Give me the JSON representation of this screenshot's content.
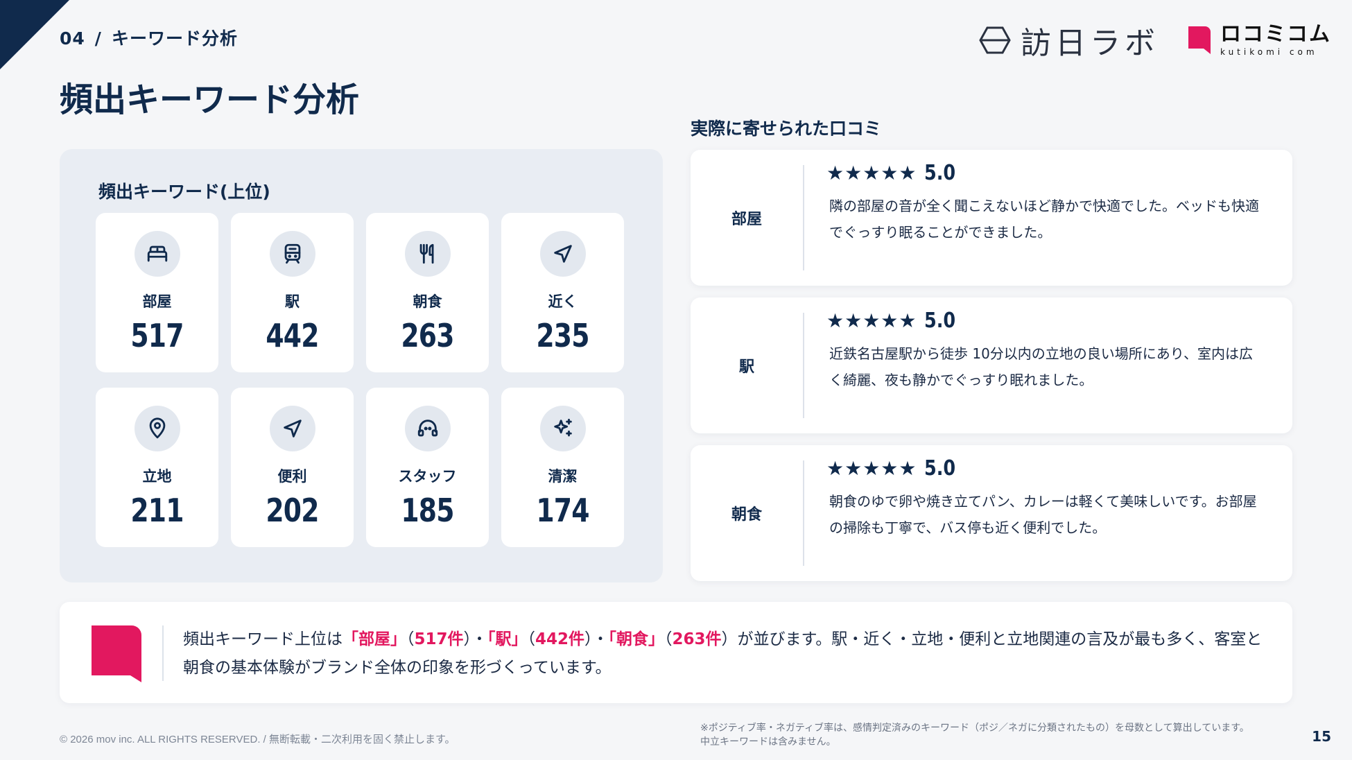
{
  "header": {
    "section_number": "04",
    "separator": "/",
    "section_name": "キーワード分析",
    "logo_houjin_text": "訪日ラボ",
    "logo_kuchikomi_jp": "ロコミコム",
    "logo_kuchikomi_en": "kutikomi com"
  },
  "page_title": "頻出キーワード分析",
  "keywords_panel": {
    "title": "頻出キーワード(上位)",
    "items": [
      {
        "label": "部屋",
        "count": "517",
        "icon": "bed-icon"
      },
      {
        "label": "駅",
        "count": "442",
        "icon": "train-icon"
      },
      {
        "label": "朝食",
        "count": "263",
        "icon": "fork-knife-icon"
      },
      {
        "label": "近く",
        "count": "235",
        "icon": "navigation-arrow-icon"
      },
      {
        "label": "立地",
        "count": "211",
        "icon": "map-pin-icon"
      },
      {
        "label": "便利",
        "count": "202",
        "icon": "navigation-arrow-icon"
      },
      {
        "label": "スタッフ",
        "count": "185",
        "icon": "headset-icon"
      },
      {
        "label": "清潔",
        "count": "174",
        "icon": "sparkles-icon"
      }
    ]
  },
  "reviews": {
    "title": "実際に寄せられた口コミ",
    "items": [
      {
        "tag": "部屋",
        "stars": "★★★★★",
        "score": "5.0",
        "text": "隣の部屋の音が全く聞こえないほど静かで快適でした。ベッドも快適でぐっすり眠ることができました。"
      },
      {
        "tag": "駅",
        "stars": "★★★★★",
        "score": "5.0",
        "text": "近鉄名古屋駅から徒歩 10分以内の立地の良い場所にあり、室内は広く綺麗、夜も静かでぐっすり眠れました。"
      },
      {
        "tag": "朝食",
        "stars": "★★★★★",
        "score": "5.0",
        "text": "朝食のゆで卵や焼き立てパン、カレーは軽くて美味しいです。お部屋の掃除も丁寧で、バス停も近く便利でした。"
      }
    ]
  },
  "summary": {
    "part1": "頻出キーワード上位は",
    "hl1": "「部屋」",
    "p2": "（",
    "hl2": "517件",
    "p3": "）・",
    "hl3": "「駅」",
    "p4": "（",
    "hl4": "442件",
    "p5": "）・",
    "hl5": "「朝食」",
    "p6": "（",
    "hl6": "263件",
    "p7": "）が並びます。駅・近く・立地・便利と立地関連の言及が最も多く、客室と朝食の基本体験がブランド全体の印象を形づくっています。"
  },
  "footer": {
    "copyright": "© 2026 mov inc. ALL RIGHTS RESERVED. / 無断転載・二次利用を固く禁止します。",
    "note": "※ポジティブ率・ネガティブ率は、感情判定済みのキーワード（ポジ／ネガに分類されたもの）を母数として算出しています。\n中立キーワードは含みません。",
    "page_number": "15"
  },
  "colors": {
    "navy": "#102a4c",
    "accent": "#e2185f",
    "panel": "#e9edf3",
    "background": "#f5f6f8"
  }
}
